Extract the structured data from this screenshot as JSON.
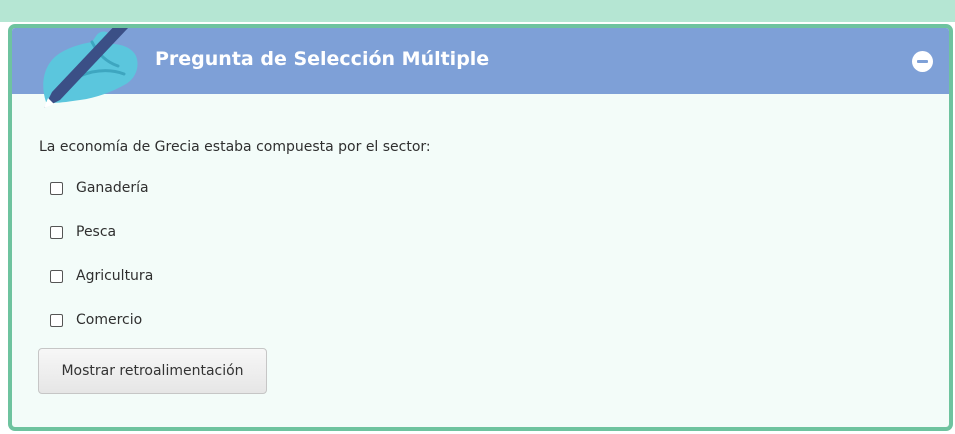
{
  "header": {
    "title": "Pregunta de Selección Múltiple",
    "icon": "pen-hand-icon",
    "collapse_icon": "minus-circle-icon"
  },
  "question": {
    "text": "La economía de Grecia estaba compuesta por el sector:",
    "options": [
      {
        "label": "Ganadería",
        "checked": false
      },
      {
        "label": "Pesca",
        "checked": false
      },
      {
        "label": "Agricultura",
        "checked": false
      },
      {
        "label": "Comercio",
        "checked": false
      }
    ]
  },
  "feedback_button": {
    "label": "Mostrar retroalimentación"
  },
  "colors": {
    "header_bg": "#7ea0d7",
    "card_border": "#6ec39f",
    "card_bg": "#f3fcf9",
    "top_strip": "#b5e6d3"
  }
}
